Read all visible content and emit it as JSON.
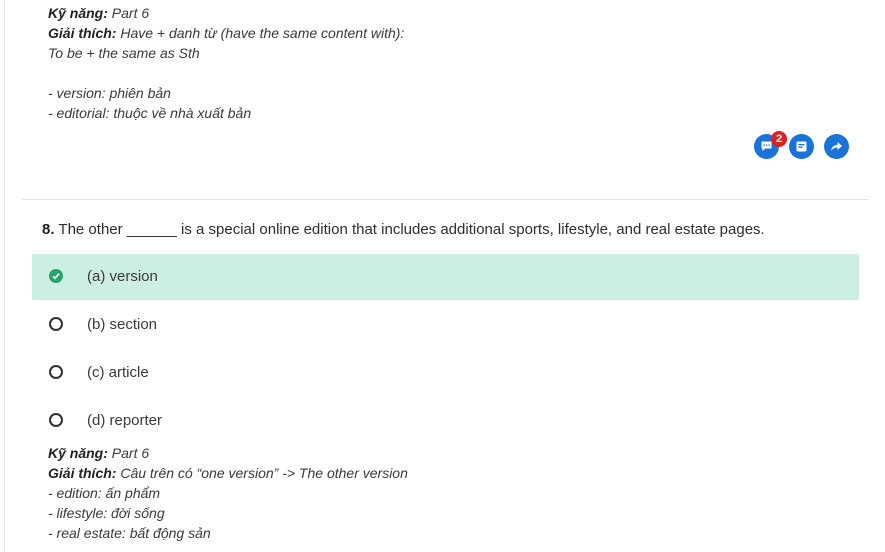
{
  "prev_explanation": {
    "skill_label": "Kỹ năng:",
    "skill_value": "Part 6",
    "explain_label": "Giải thích:",
    "explain_value": "Have + danh từ (have the same content with):",
    "lines": [
      "To be + the same as Sth",
      "",
      "- version: phiên bản",
      "- editorial: thuộc về nhà xuất bản"
    ]
  },
  "actions": {
    "comment_icon": "comment-icon",
    "comment_count": "2",
    "note_icon": "note-icon",
    "share_icon": "share-arrow-icon",
    "accent_color": "#1a73d9",
    "badge_color": "#e02020"
  },
  "question": {
    "number": "8.",
    "text": "The other ______ is a special online edition that includes additional sports, lifestyle, and real estate pages."
  },
  "options": [
    {
      "label": "(a) version",
      "selected": true,
      "correct": true
    },
    {
      "label": "(b) section",
      "selected": false
    },
    {
      "label": "(c) article",
      "selected": false
    },
    {
      "label": "(d) reporter",
      "selected": false
    }
  ],
  "correct_color": "#cceee3",
  "explanation": {
    "skill_label": "Kỹ năng:",
    "skill_value": "Part 6",
    "explain_label": "Giải thích:",
    "explain_value": "Câu trên có “one version” -> The other version",
    "lines": [
      "- edition: ấn phẩm",
      "- lifestyle: đời sống",
      "- real estate: bất động sản"
    ]
  }
}
